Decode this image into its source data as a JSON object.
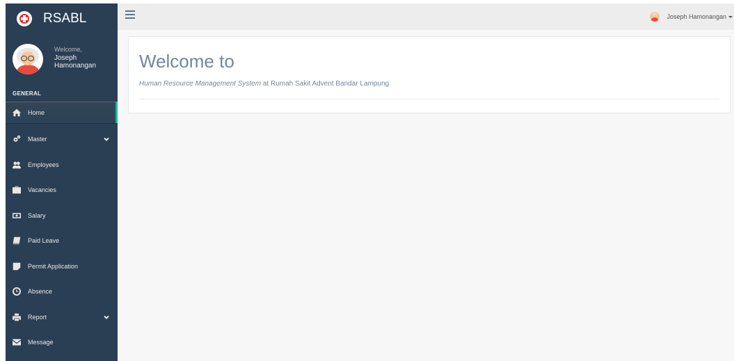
{
  "brand": {
    "name": "RSABL"
  },
  "profile": {
    "welcome": "Welcome,",
    "name": "Joseph Hamonangan"
  },
  "sidebar": {
    "section_title": "GENERAL",
    "items": [
      {
        "label": "Home",
        "icon": "home-icon",
        "active": true
      },
      {
        "label": "Master",
        "icon": "cogs-icon",
        "has_submenu": true
      },
      {
        "label": "Employees",
        "icon": "users-icon"
      },
      {
        "label": "Vacancies",
        "icon": "briefcase-icon"
      },
      {
        "label": "Salary",
        "icon": "money-icon"
      },
      {
        "label": "Paid Leave",
        "icon": "book-icon"
      },
      {
        "label": "Permit Application",
        "icon": "sticky-note-icon"
      },
      {
        "label": "Absence",
        "icon": "clock-icon"
      },
      {
        "label": "Report",
        "icon": "print-icon",
        "has_submenu": true
      },
      {
        "label": "Message",
        "icon": "envelope-icon"
      }
    ]
  },
  "topnav": {
    "user_name": "Joseph Hamonangan"
  },
  "main": {
    "title": "Welcome to",
    "subtitle_em": "Human Resource Management System",
    "subtitle_rest": " at Rumah Sakit Advent Bandar Lampung"
  },
  "colors": {
    "sidebar_bg": "#2a3f54",
    "active_border": "#1ABB9C",
    "content_bg": "#F7F7F7",
    "text_muted": "#73879C"
  }
}
